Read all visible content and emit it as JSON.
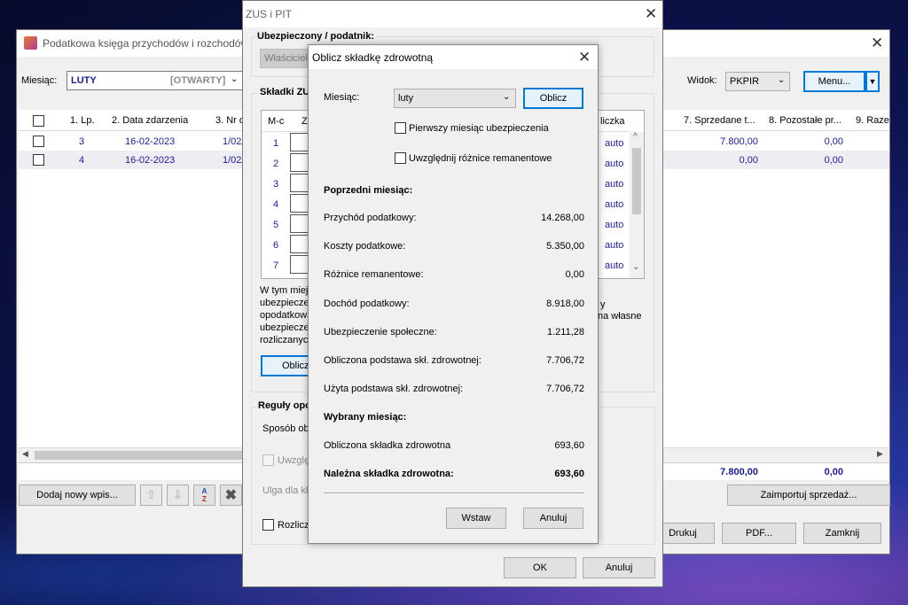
{
  "main_window": {
    "title": "Podatkowa księga przychodów i rozchodów",
    "month_label": "Miesiąc:",
    "month_value": "LUTY",
    "month_status": "[OTWARTY]",
    "view_label": "Widok:",
    "view_value": "PKPIR",
    "menu_button": "Menu...",
    "columns": [
      "1. Lp.",
      "2. Data zdarzenia",
      "3. Nr d",
      "7. Sprzedane t...",
      "8. Pozostałe pr...",
      "9. Raze"
    ],
    "rows": [
      {
        "lp": "3",
        "date": "16-02-2023",
        "nr": "1/02/",
        "sold": "7.800,00",
        "other": "0,00"
      },
      {
        "lp": "4",
        "date": "16-02-2023",
        "nr": "1/02/",
        "sold": "0,00",
        "other": "0,00"
      }
    ],
    "totals": {
      "sold": "7.800,00",
      "other": "0,00"
    },
    "add_button": "Dodaj nowy wpis...",
    "import_button": "Zaimportuj sprzedaż...",
    "print_button": "Drukuj",
    "pdf_button": "PDF...",
    "close_button": "Zamknij"
  },
  "zus_window": {
    "title": "ZUS i PIT",
    "insured_section": "Ubezpieczony / podatnik:",
    "owner_value": "Właściciel",
    "contributions_section": "Składki ZUS",
    "table_header_month": "M-c",
    "table_header_z": "Z",
    "table_header_right": "liczka",
    "months": [
      "1",
      "2",
      "3",
      "4",
      "5",
      "6",
      "7"
    ],
    "auto_label": "auto",
    "info_lines": [
      "W tym miejs",
      "ubezpieczei",
      "opodatkowa",
      "ubezpieczei",
      "rozliczanycl"
    ],
    "info_right_1": "y",
    "info_right_2": "na własne",
    "calc_button": "Oblicz",
    "rules_section": "Reguły opo",
    "method_label": "Sposób ob",
    "consider_label": "Uwzglę",
    "relief_label": "Ulga dla kl",
    "settle_label": "Rozlicz",
    "ok_button": "OK",
    "cancel_button": "Anuluj"
  },
  "dialog": {
    "title": "Oblicz składkę zdrowotną",
    "month_label": "Miesiąc:",
    "month_value": "luty",
    "calc_button": "Oblicz",
    "first_month_label": "Pierwszy miesiąc ubezpieczenia",
    "inventory_label": "Uwzględnij różnice remanentowe",
    "prev_month_header": "Poprzedni miesiąc:",
    "rows": [
      {
        "label": "Przychód podatkowy:",
        "value": "14.268,00"
      },
      {
        "label": "Koszty podatkowe:",
        "value": "5.350,00"
      },
      {
        "label": "Różnice remanentowe:",
        "value": "0,00"
      },
      {
        "label": "Dochód podatkowy:",
        "value": "8.918,00"
      },
      {
        "label": "Ubezpieczenie społeczne:",
        "value": "1.211,28"
      },
      {
        "label": "Obliczona podstawa skł. zdrowotnej:",
        "value": "7.706,72"
      },
      {
        "label": "Użyta podstawa skł. zdrowotnej:",
        "value": "7.706,72"
      }
    ],
    "selected_month_header": "Wybrany miesiąc:",
    "computed_fee_label": "Obliczona składka zdrowotna",
    "computed_fee_value": "693,60",
    "due_fee_label": "Należna składka zdrowotna:",
    "due_fee_value": "693,60",
    "insert_button": "Wstaw",
    "cancel_button": "Anuluj"
  }
}
